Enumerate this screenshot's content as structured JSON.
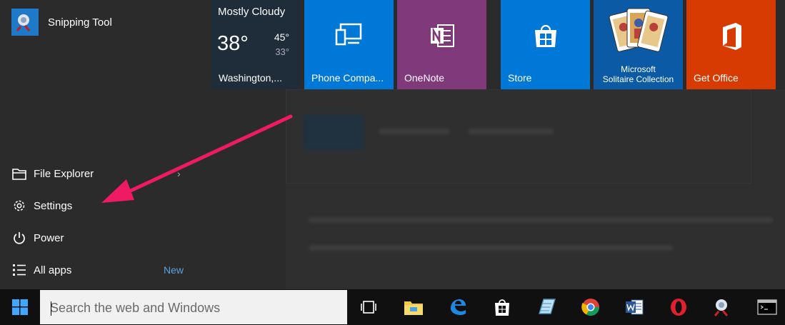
{
  "apps": {
    "snipping_tool": "Snipping Tool"
  },
  "nav": {
    "file_explorer": "File Explorer",
    "settings": "Settings",
    "power": "Power",
    "all_apps": "All apps",
    "new_badge": "New"
  },
  "tiles": {
    "weather": {
      "condition": "Mostly Cloudy",
      "temp": "38°",
      "high": "45°",
      "low": "33°",
      "location": "Washington,..."
    },
    "phone": "Phone Compa...",
    "onenote": "OneNote",
    "store": "Store",
    "solitaire_line1": "Microsoft",
    "solitaire_line2": "Solitaire Collection",
    "office": "Get Office"
  },
  "taskbar": {
    "search_placeholder": "Search the web and Windows",
    "pinned": [
      "task-view-icon",
      "file-explorer-icon",
      "edge-icon",
      "store-icon",
      "notepad-icon",
      "chrome-icon",
      "word-icon",
      "opera-icon",
      "snipping-tool-icon",
      "command-prompt-icon"
    ]
  },
  "colors": {
    "accent_blue": "#0078d7",
    "onenote_purple": "#80397b",
    "office_orange": "#d83b01",
    "arrow_pink": "#ee1a63"
  }
}
